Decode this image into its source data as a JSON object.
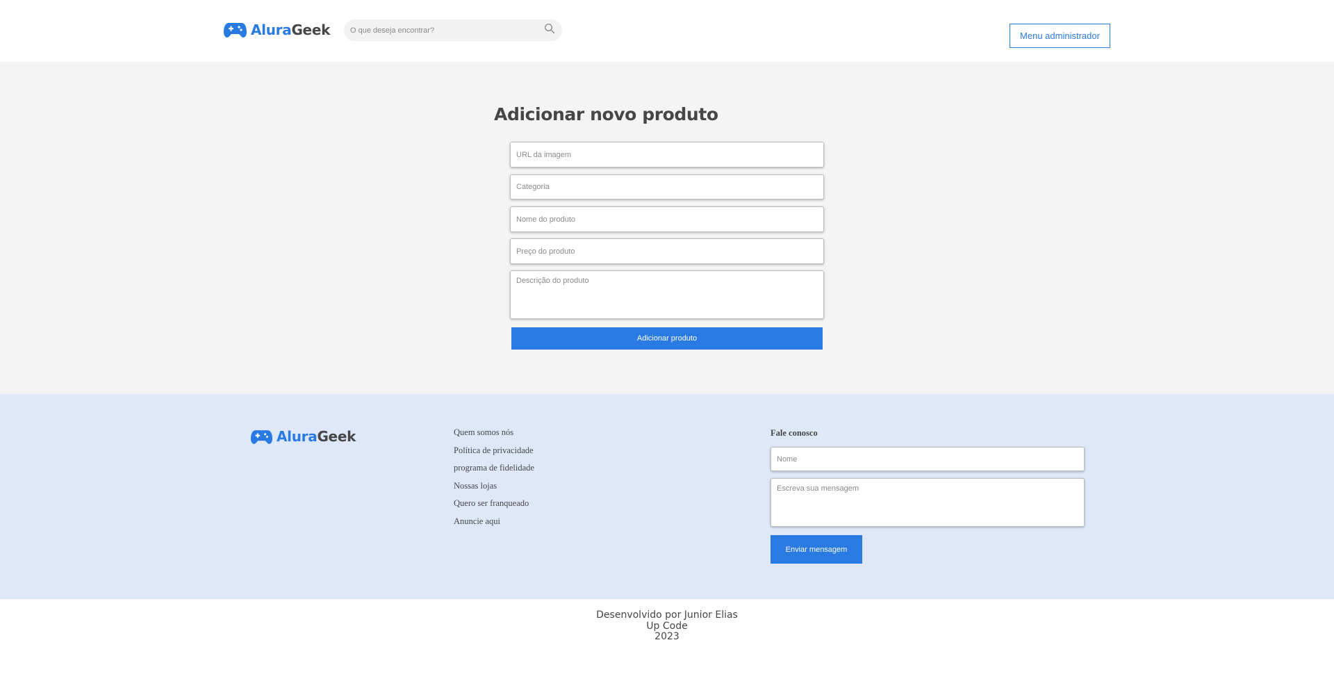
{
  "header": {
    "logo": {
      "brand_part1": "Alura",
      "brand_part2": "Geek",
      "icon": "gamepad-icon"
    },
    "search": {
      "placeholder": "O que deseja encontrar?",
      "value": "",
      "icon": "search-icon"
    },
    "admin_button_label": "Menu administrador"
  },
  "main": {
    "title": "Adicionar novo produto",
    "form": {
      "image_url_placeholder": "URL da imagem",
      "category_placeholder": "Categoria",
      "name_placeholder": "Nome do produto",
      "price_placeholder": "Preço do produto",
      "description_placeholder": "Descrição do produto",
      "submit_label": "Adicionar produto"
    }
  },
  "footer": {
    "logo": {
      "brand_part1": "Alura",
      "brand_part2": "Geek",
      "icon": "gamepad-icon"
    },
    "links": [
      "Quem somos nós",
      "Política de privacidade",
      "programa de fidelidade",
      "Nossas lojas",
      "Quero ser franqueado",
      "Anuncie aqui"
    ],
    "contact": {
      "title": "Fale conosco",
      "name_placeholder": "Nome",
      "message_placeholder": "Escreva sua mensagem",
      "submit_label": "Enviar mensagem"
    }
  },
  "credits": {
    "line1": "Desenvolvido por Junior Elias",
    "line2": "Up Code",
    "line3": "2023"
  },
  "colors": {
    "accent": "#2a7ae4",
    "text": "#464646",
    "main_bg": "#f4f4f4",
    "footer_bg": "#dfe8f9"
  }
}
